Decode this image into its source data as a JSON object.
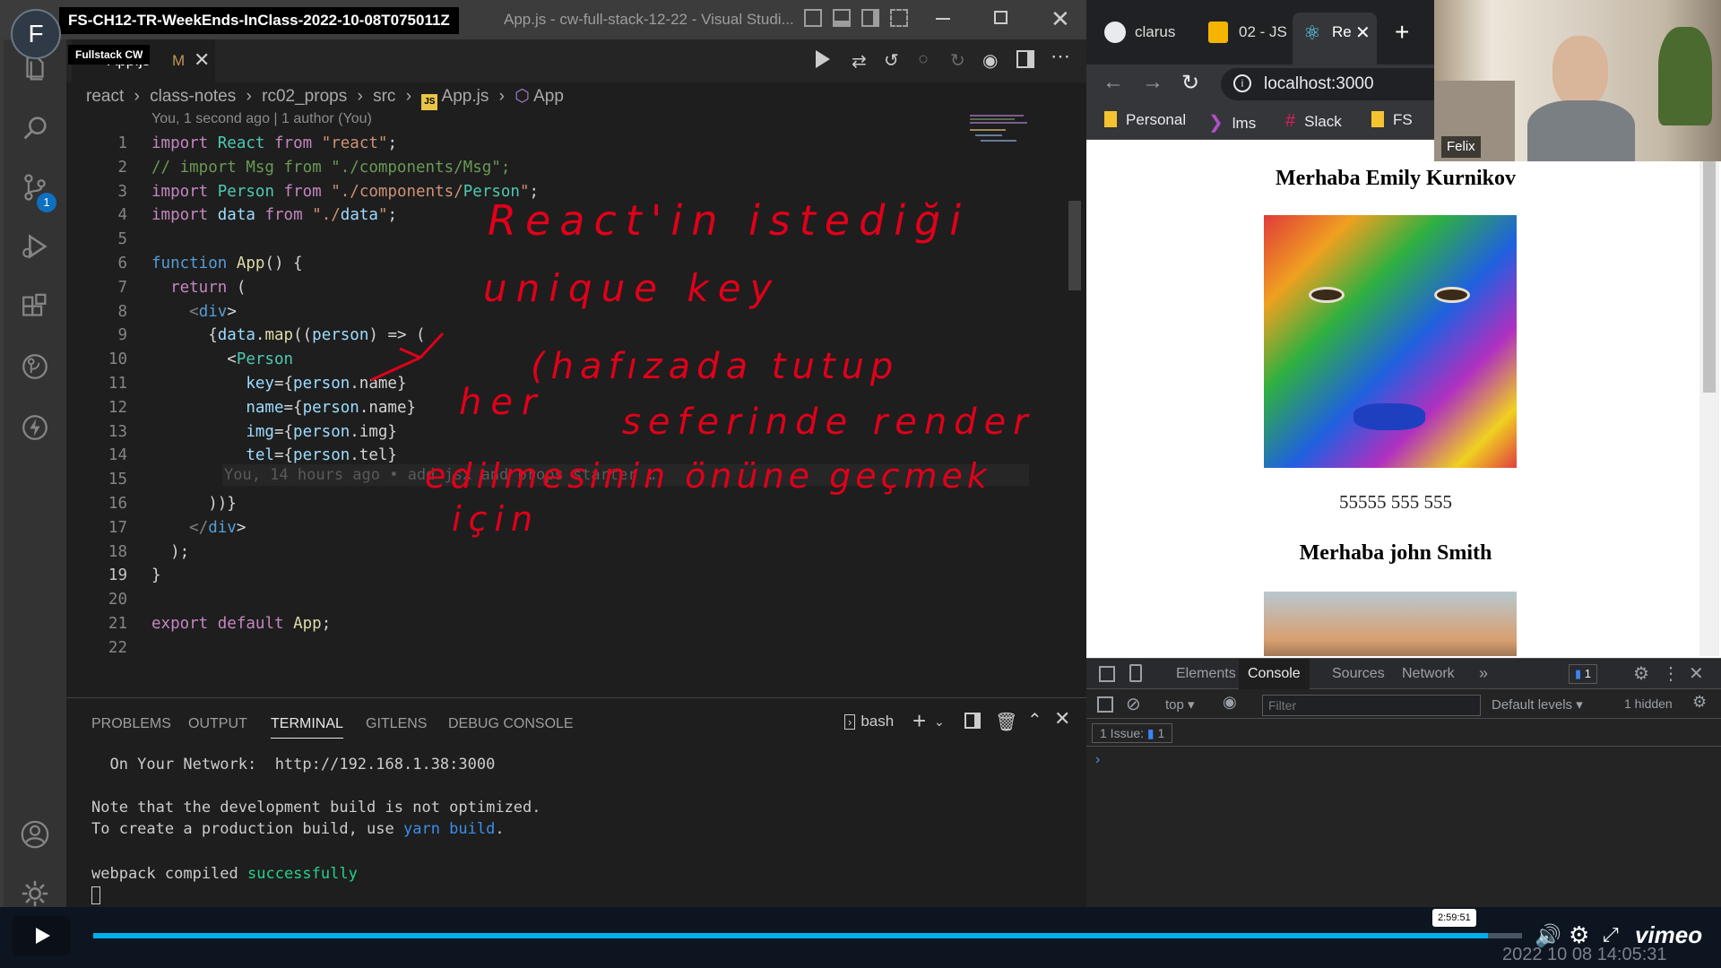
{
  "vscode": {
    "window_title": "App.js - cw-full-stack-12-22 - Visual Studi...",
    "session_title": "FS-CH12-TR-WeekEnds-InClass-2022-10-08T075011Z",
    "avatar_letter": "F",
    "avatar_tooltip": "Fullstack CW",
    "tab": {
      "name": "App.js",
      "modified_flag": "M"
    },
    "breadcrumb": [
      "react",
      "class-notes",
      "rc02_props",
      "src",
      "App.js",
      "App"
    ],
    "blame_header": "You, 1 second ago | 1 author (You)",
    "inline_blame": "You, 14 hours ago • add jsx and props starter …",
    "source_control_badge": "1",
    "code_lines": [
      "import React from \"react\";",
      "// import Msg from \"./components/Msg\";",
      "import Person from \"./components/Person\";",
      "import data from \"./data\";",
      "",
      "function App() {",
      "  return (",
      "    <div>",
      "      {data.map((person) => (",
      "        <Person",
      "          key={person.name}",
      "          name={person.name}",
      "          img={person.img}",
      "          tel={person.tel}",
      "        />",
      "      ))}",
      "    </div>",
      "  );",
      "}",
      "",
      "export default App;",
      ""
    ],
    "line_numbers": [
      "1",
      "2",
      "3",
      "4",
      "5",
      "6",
      "7",
      "8",
      "9",
      "10",
      "11",
      "12",
      "13",
      "14",
      "15",
      "16",
      "17",
      "18",
      "19",
      "20",
      "21",
      "22"
    ],
    "annotation_lines": [
      "React'in istediği",
      "unique key",
      "(hafızada tutup",
      "her",
      "seferinde render",
      "edilmesinin önüne geçmek",
      "için"
    ],
    "panel": {
      "tabs": [
        "PROBLEMS",
        "OUTPUT",
        "TERMINAL",
        "GITLENS",
        "DEBUG CONSOLE"
      ],
      "active_tab": "TERMINAL",
      "shell": "bash",
      "terminal_lines": [
        "  On Your Network:  http://192.168.1.38:3000",
        "",
        "Note that the development build is not optimized.",
        "To create a production build, use yarn build.",
        "",
        "webpack compiled successfully"
      ],
      "yarn_build": "yarn build",
      "success_word": "successfully"
    }
  },
  "browser": {
    "tabs": [
      {
        "label": "clarus",
        "icon": "github-icon"
      },
      {
        "label": "02 - JS",
        "icon": "slides-icon"
      },
      {
        "label": "Re",
        "icon": "react-icon"
      }
    ],
    "url": "localhost:3000",
    "bookmarks": [
      "Personal",
      "lms",
      "Slack",
      "FS"
    ],
    "page": {
      "persons": [
        {
          "greeting": "Merhaba Emily Kurnikov",
          "tel": "55555 555 555"
        },
        {
          "greeting": "Merhaba john Smith",
          "tel": ""
        }
      ]
    },
    "devtools": {
      "tabs": [
        "Elements",
        "Console",
        "Sources",
        "Network"
      ],
      "active_tab": "Console",
      "issues_badge": "1",
      "context": "top",
      "filter_placeholder": "Filter",
      "levels": "Default levels",
      "hidden": "1 hidden",
      "issue_label": "1 Issue:",
      "issue_count": "1"
    }
  },
  "webcam": {
    "name": "Felix"
  },
  "player": {
    "time_tooltip": "2:59:51",
    "progress": 0.976,
    "timestamp_overlay": "2022 10 08 14:05:31",
    "brand": "vimeo"
  }
}
